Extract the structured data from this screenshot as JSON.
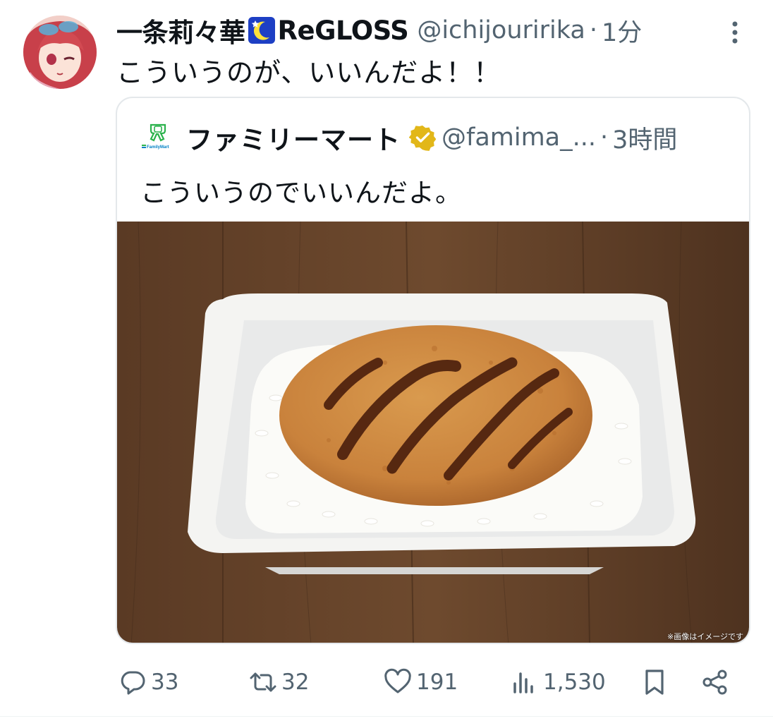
{
  "tweet": {
    "display_name": "一条莉々華",
    "badge_icon": "crescent-moon-star-emoji",
    "display_name_suffix": "ReGLOSS",
    "handle": "@ichijouririka",
    "separator": "·",
    "time": "1分",
    "text": "こういうのが、いいんだよ！！"
  },
  "quote": {
    "display_name": "ファミリーマート",
    "verified": true,
    "verified_color": "#e2b719",
    "handle": "@famima_...",
    "separator": "·",
    "time": "3時間",
    "text": "こういうのでいいんだよ。",
    "image_caption": "※画像はイメージです",
    "avatar_logo_text": "FamilyMart"
  },
  "actions": {
    "reply_count": "33",
    "retweet_count": "32",
    "like_count": "191",
    "view_count": "1,530"
  },
  "colors": {
    "text_primary": "#0f1419",
    "text_secondary": "#536471",
    "border": "#e4e8eb",
    "familymart_green": "#2bb24c",
    "familymart_blue": "#0081c5"
  }
}
